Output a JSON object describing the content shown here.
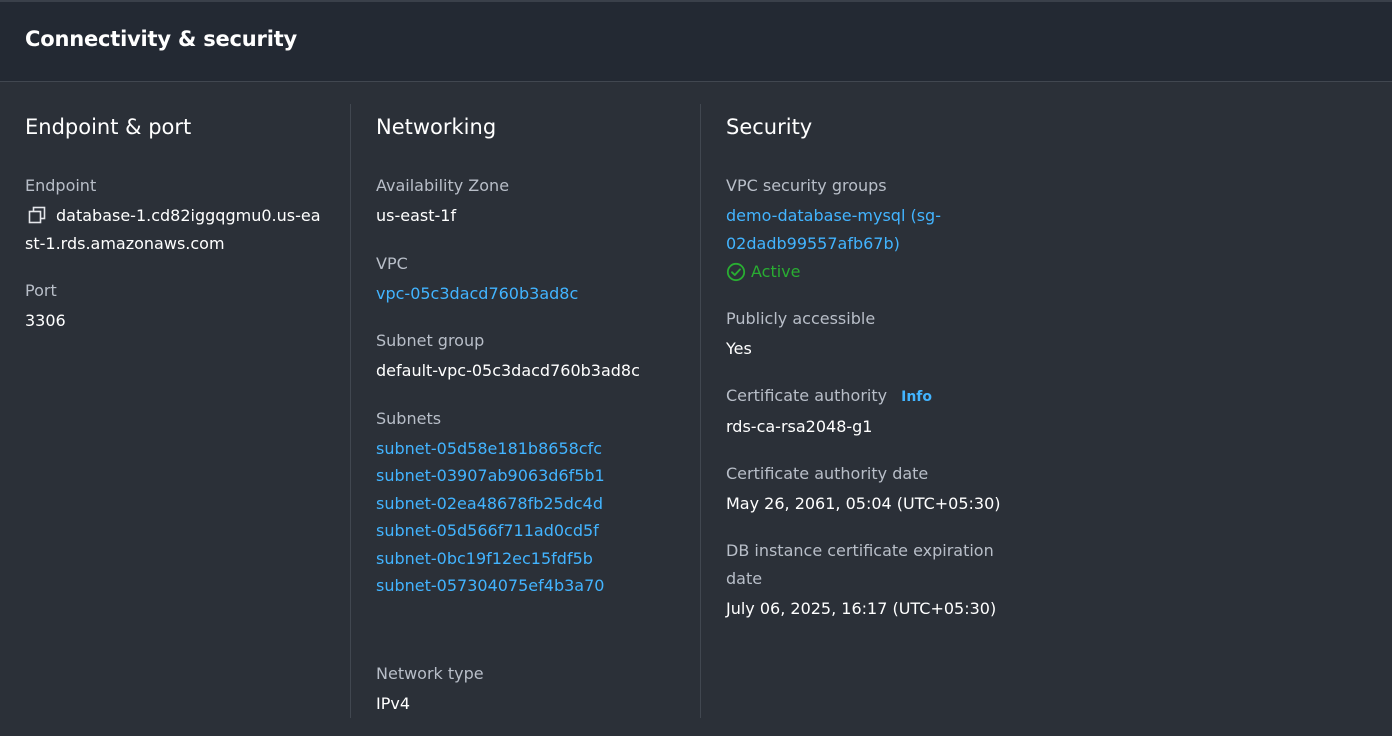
{
  "panel": {
    "title": "Connectivity & security"
  },
  "endpoint_port": {
    "title": "Endpoint & port",
    "endpoint_label": "Endpoint",
    "endpoint_value": "database-1.cd82iggqgmu0.us-east-1.rds.amazonaws.com",
    "copy_icon": "copy-icon",
    "port_label": "Port",
    "port_value": "3306"
  },
  "networking": {
    "title": "Networking",
    "az_label": "Availability Zone",
    "az_value": "us-east-1f",
    "vpc_label": "VPC",
    "vpc_value": "vpc-05c3dacd760b3ad8c",
    "subnet_group_label": "Subnet group",
    "subnet_group_value": "default-vpc-05c3dacd760b3ad8c",
    "subnets_label": "Subnets",
    "subnets": [
      "subnet-05d58e181b8658cfc",
      "subnet-03907ab9063d6f5b1",
      "subnet-02ea48678fb25dc4d",
      "subnet-05d566f711ad0cd5f",
      "subnet-0bc19f12ec15fdf5b",
      "subnet-057304075ef4b3a70"
    ],
    "network_type_label": "Network type",
    "network_type_value": "IPv4"
  },
  "security": {
    "title": "Security",
    "sg_label": "VPC security groups",
    "sg_link_line1": "demo-database-mysql (sg-",
    "sg_link_line2": "02dadb99557afb67b)",
    "sg_status": "Active",
    "public_label": "Publicly accessible",
    "public_value": "Yes",
    "ca_label": "Certificate authority",
    "ca_info": "Info",
    "ca_value": "rds-ca-rsa2048-g1",
    "ca_date_label": "Certificate authority date",
    "ca_date_value": "May 26, 2061, 05:04 (UTC+05:30)",
    "db_cert_label_line1": "DB instance certificate expiration",
    "db_cert_label_line2": "date",
    "db_cert_value": "July 06, 2025, 16:17 (UTC+05:30)"
  },
  "colors": {
    "background": "#2b3038",
    "header_background": "#232933",
    "link": "#42b4ff",
    "status_active": "#29ad32",
    "label": "#b8bec8",
    "value": "#ffffff"
  }
}
